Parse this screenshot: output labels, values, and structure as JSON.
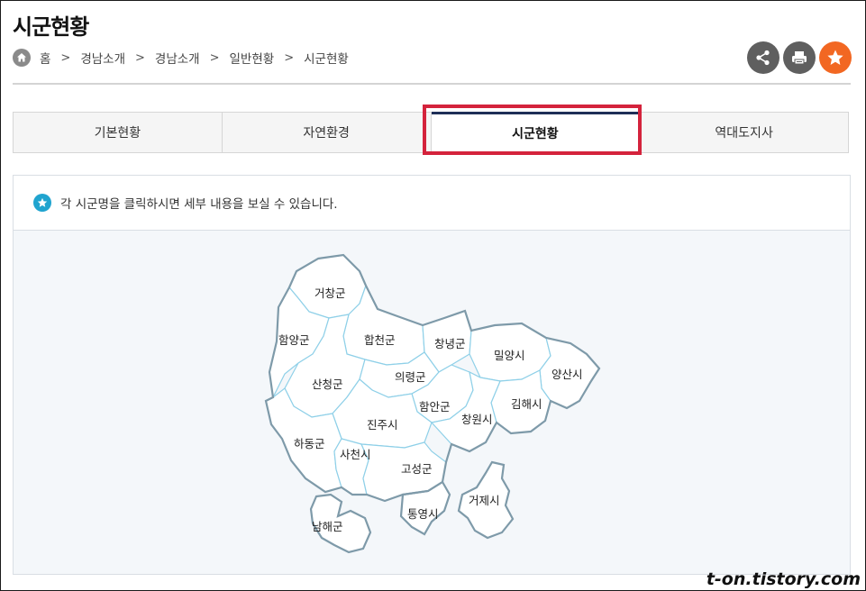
{
  "page": {
    "title": "시군현황"
  },
  "breadcrumb": {
    "items": [
      "홈",
      "경남소개",
      "경남소개",
      "일반현황",
      "시군현황"
    ],
    "separator": ">"
  },
  "actions": {
    "share_icon": "share-icon",
    "print_icon": "print-icon",
    "favorite_icon": "star-icon",
    "accent": "#f26722"
  },
  "tabs": [
    {
      "label": "기본현황",
      "active": false
    },
    {
      "label": "자연환경",
      "active": false
    },
    {
      "label": "시군현황",
      "active": true
    },
    {
      "label": "역대도지사",
      "active": false
    }
  ],
  "notice": {
    "text": "각 시군명을 클릭하시면 세부 내용을 보실 수 있습니다."
  },
  "map": {
    "regions": [
      {
        "id": "geochang",
        "label": "거창군"
      },
      {
        "id": "hamyang",
        "label": "함양군"
      },
      {
        "id": "hapcheon",
        "label": "합천군"
      },
      {
        "id": "changnyeong",
        "label": "창녕군"
      },
      {
        "id": "miryang",
        "label": "밀양시"
      },
      {
        "id": "yangsan",
        "label": "양산시"
      },
      {
        "id": "sancheong",
        "label": "산청군"
      },
      {
        "id": "uiryeong",
        "label": "의령군"
      },
      {
        "id": "haman",
        "label": "함안군"
      },
      {
        "id": "gimhae",
        "label": "김해시"
      },
      {
        "id": "jinju",
        "label": "진주시"
      },
      {
        "id": "changwon",
        "label": "창원시"
      },
      {
        "id": "hadong",
        "label": "하동군"
      },
      {
        "id": "sacheon",
        "label": "사천시"
      },
      {
        "id": "goseong",
        "label": "고성군"
      },
      {
        "id": "geoje",
        "label": "거제시"
      },
      {
        "id": "tongyeong",
        "label": "통영시"
      },
      {
        "id": "namhae",
        "label": "남해군"
      }
    ]
  },
  "watermark": "t-on.tistory.com"
}
